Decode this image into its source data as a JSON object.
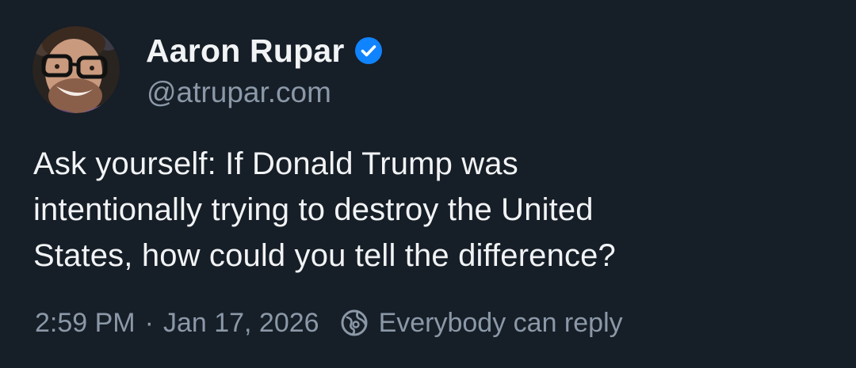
{
  "author": {
    "display_name": "Aaron Rupar",
    "handle": "@atrupar.com",
    "verified": true,
    "avatar_icon": "user-avatar-photo"
  },
  "post": {
    "text": "Ask yourself: If Donald Trump was intentionally trying to destroy the United States, how could you tell the difference?",
    "lines": [
      "Ask yourself: If Donald Trump was",
      "intentionally trying to destroy the United",
      "States, how could you tell the difference?"
    ]
  },
  "meta": {
    "time": "2:59 PM",
    "separator": "·",
    "date": "Jan 17, 2026",
    "reply_setting": "Everybody can reply",
    "reply_icon": "globe-icon"
  },
  "colors": {
    "background": "#161e27",
    "primary_text": "#f1f3f5",
    "secondary_text": "#8b98a8",
    "verified_badge": "#1083fe"
  }
}
